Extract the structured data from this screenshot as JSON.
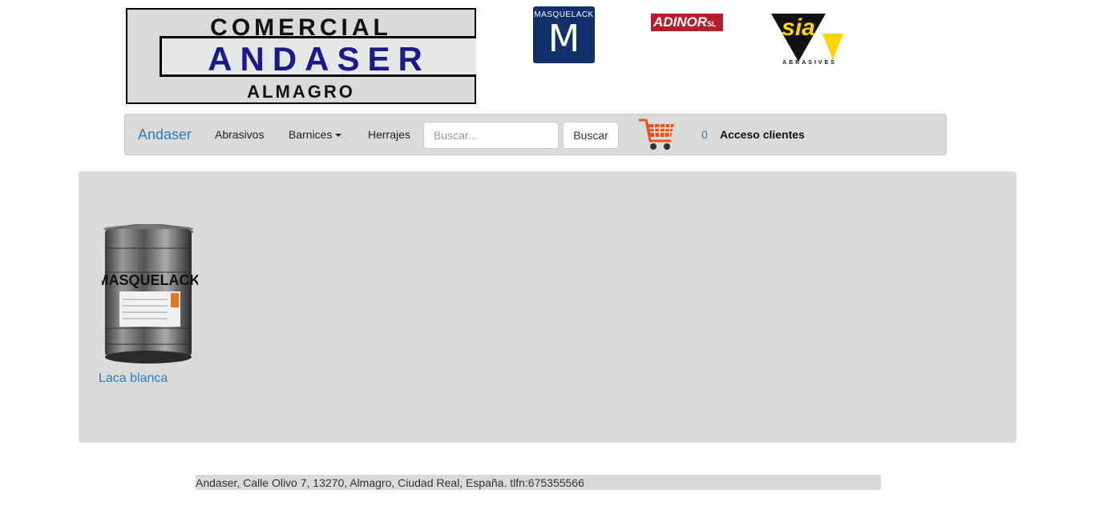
{
  "header": {
    "logo_main": {
      "line1": "COMERCIAL",
      "line2": "ANDASER",
      "line3": "ALMAGRO"
    },
    "logo_masquelack": {
      "text": "MASQUELACK",
      "letter": "M"
    },
    "logo_adinor": {
      "text": "ADINOR",
      "suffix": "SL"
    },
    "logo_sia": {
      "text": "sia",
      "caption": "ABRASIVES"
    }
  },
  "navbar": {
    "brand": "Andaser",
    "links": [
      "Abrasivos",
      "Barnices",
      "Herrajes"
    ],
    "search": {
      "placeholder": "Buscar...",
      "button": "Buscar"
    },
    "cart_count": "0",
    "clients": "Acceso clientes"
  },
  "products": [
    {
      "name": "Laca blanca",
      "image_label": "MASQUELACK"
    }
  ],
  "footer": {
    "text": "Andaser, Calle Olivo 7, 13270, Almagro, Ciudad Real, España. tlfn:675355566"
  },
  "colors": {
    "panel": "#d9dbdb",
    "link": "#337ab7",
    "masquelack_blue": "#12306a",
    "adinor_red": "#b41f2e",
    "sia_yellow": "#ffd400"
  }
}
